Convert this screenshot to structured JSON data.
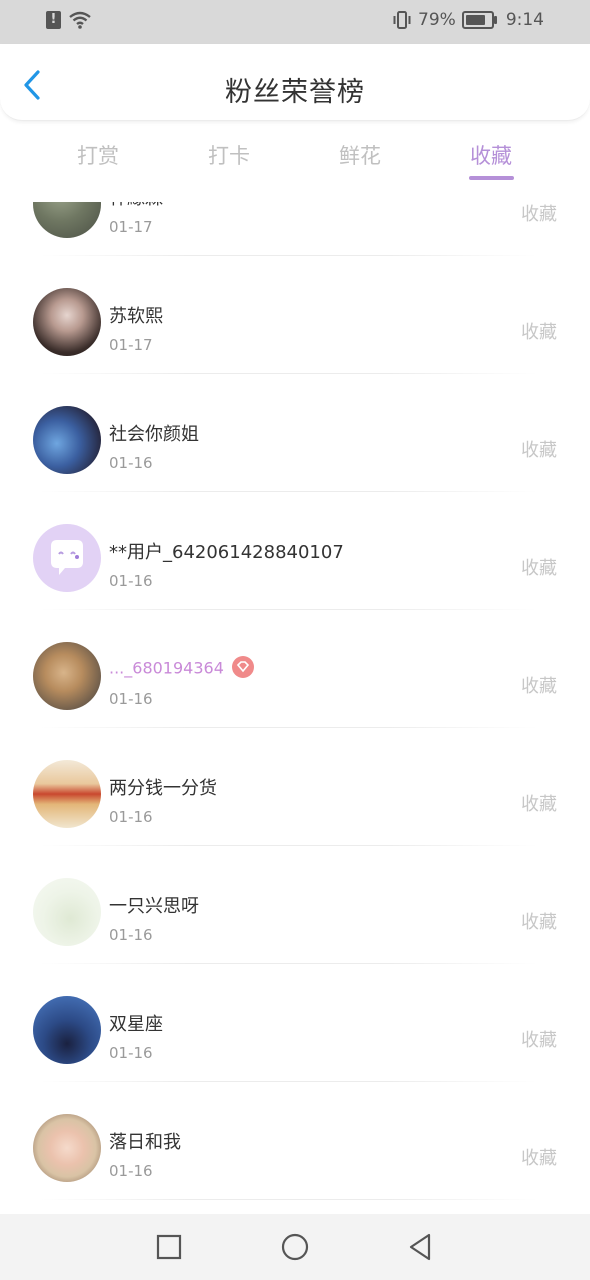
{
  "status_bar": {
    "battery_percent": "79%",
    "battery_level": 0.79,
    "time": "9:14"
  },
  "header": {
    "title": "粉丝荣誉榜"
  },
  "tabs": [
    {
      "label": "打赏",
      "active": false
    },
    {
      "label": "打卡",
      "active": false
    },
    {
      "label": "鲜花",
      "active": false
    },
    {
      "label": "收藏",
      "active": true
    }
  ],
  "list": [
    {
      "name": "杯緣森",
      "date": "01-17",
      "action": "收藏",
      "avatar_icon": "photo-avatar"
    },
    {
      "name": "苏软熙",
      "date": "01-17",
      "action": "收藏",
      "avatar_icon": "photo-avatar"
    },
    {
      "name": "社会你颜姐",
      "date": "01-16",
      "action": "收藏",
      "avatar_icon": "photo-avatar"
    },
    {
      "name": "**用户_642061428840107",
      "date": "01-16",
      "action": "收藏",
      "avatar_icon": "default-chat-avatar"
    },
    {
      "name": "..._680194364",
      "date": "01-16",
      "action": "收藏",
      "avatar_icon": "photo-avatar",
      "vip": true
    },
    {
      "name": "两分钱一分货",
      "date": "01-16",
      "action": "收藏",
      "avatar_icon": "photo-avatar"
    },
    {
      "name": "一只兴思呀",
      "date": "01-16",
      "action": "收藏",
      "avatar_icon": "photo-avatar"
    },
    {
      "name": "双星座",
      "date": "01-16",
      "action": "收藏",
      "avatar_icon": "photo-avatar"
    },
    {
      "name": "落日和我",
      "date": "01-16",
      "action": "收藏",
      "avatar_icon": "photo-avatar"
    }
  ],
  "colors": {
    "accent": "#b590d8",
    "vip_name": "#c98ad8",
    "vip_badge": "#f08a8a",
    "back_arrow": "#2196e6"
  },
  "nav_bar": {
    "icons": [
      "square-icon",
      "circle-icon",
      "back-triangle-icon"
    ]
  }
}
